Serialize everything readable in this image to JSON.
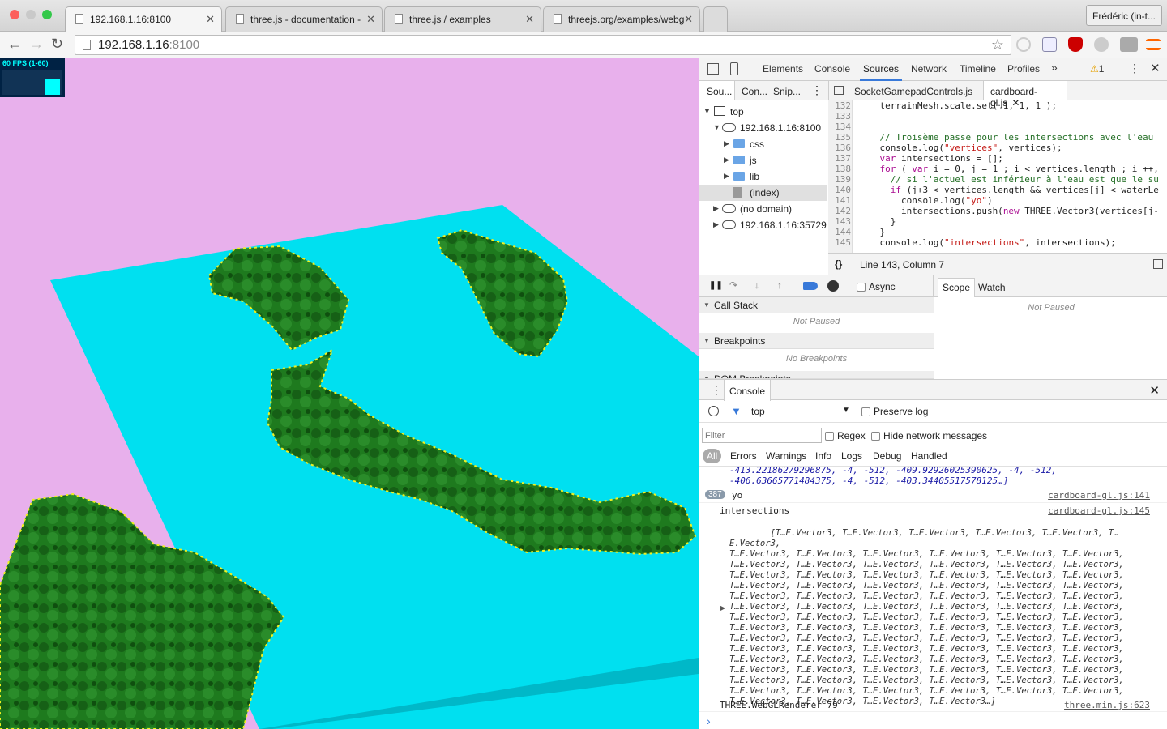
{
  "browser": {
    "tabs": [
      {
        "title": "192.168.1.16:8100",
        "active": true
      },
      {
        "title": "three.js - documentation - ",
        "active": false
      },
      {
        "title": "three.js / examples",
        "active": false
      },
      {
        "title": "threejs.org/examples/webg",
        "active": false
      }
    ],
    "profile": "Frédéric (in-t...",
    "url_host": "192.168.1.16",
    "url_port": ":8100"
  },
  "viewport": {
    "fps_label": "60 FPS (1-60)",
    "colors": {
      "background": "#e8b0ec",
      "water": "#00e0f0",
      "land": "#1e7a1e",
      "shoreline": "#f0f020"
    }
  },
  "devtools": {
    "tabs": [
      "Elements",
      "Console",
      "Sources",
      "Network",
      "Timeline",
      "Profiles"
    ],
    "selected_tab": "Sources",
    "warning_count": "1",
    "navigator_tabs": [
      "Sou...",
      "Con...",
      "Snip..."
    ],
    "file_tabs": [
      "SocketGamepadControls.js",
      "cardboard-gl.js"
    ],
    "tree": [
      {
        "label": "top",
        "icon": "frame-icon"
      },
      {
        "label": "192.168.1.16:8100",
        "icon": "cloud-icon"
      },
      {
        "label": "css",
        "icon": "folder-icon"
      },
      {
        "label": "js",
        "icon": "folder-icon"
      },
      {
        "label": "lib",
        "icon": "folder-icon"
      },
      {
        "label": "(index)",
        "icon": "file-icon"
      },
      {
        "label": "(no domain)",
        "icon": "cloud-icon"
      },
      {
        "label": "192.168.1.16:35729",
        "icon": "cloud-icon"
      }
    ],
    "code_lines": [
      {
        "n": "132",
        "text": "    terrainMesh.scale.set( 1, 1, 1 );"
      },
      {
        "n": "133",
        "text": ""
      },
      {
        "n": "134",
        "text": ""
      },
      {
        "n": "135",
        "text": "    // Troisème passe pour les intersections avec l'eau"
      },
      {
        "n": "136",
        "text": "    console.log(\"vertices\", vertices);"
      },
      {
        "n": "137",
        "text": "    var intersections = [];"
      },
      {
        "n": "138",
        "text": "    for ( var i = 0, j = 1 ; i < vertices.length ; i ++,"
      },
      {
        "n": "139",
        "text": "      // si l'actuel est inférieur à l'eau est que le su"
      },
      {
        "n": "140",
        "text": "      if (j+3 < vertices.length && vertices[j] < waterLe"
      },
      {
        "n": "141",
        "text": "        console.log(\"yo\")"
      },
      {
        "n": "142",
        "text": "        intersections.push(new THREE.Vector3(vertices[j-"
      },
      {
        "n": "143",
        "text": "      }"
      },
      {
        "n": "144",
        "text": "    }"
      },
      {
        "n": "145",
        "text": "    console.log(\"intersections\", intersections);"
      }
    ],
    "status_position": "Line 143, Column 7",
    "async_label": "Async",
    "call_stack": {
      "title": "Call Stack",
      "status": "Not Paused"
    },
    "breakpoints": {
      "title": "Breakpoints",
      "status": "No Breakpoints"
    },
    "dom_breakpoints": "DOM Breakpoints",
    "scope_tabs": [
      "Scope",
      "Watch"
    ],
    "scope_status": "Not Paused",
    "console": {
      "title": "Console",
      "context": "top",
      "preserve_log": "Preserve log",
      "filter_placeholder": "Filter",
      "regex": "Regex",
      "hide_network": "Hide network messages",
      "levels": [
        "All",
        "Errors",
        "Warnings",
        "Info",
        "Logs",
        "Debug",
        "Handled"
      ],
      "partial_lines": [
        "-413.22186279296875, -4, -512, -409.92926025390625, -4, -512,",
        "-406.63665771484375, -4, -512, -403.34405517578125…]"
      ],
      "yo_count": "387",
      "yo_text": "yo",
      "yo_source": "cardboard-gl.js:141",
      "intersections_label": "intersections",
      "intersections_source": "cardboard-gl.js:145",
      "vector_text": "T…E.Vector3",
      "renderer_text": "THREE.WebGLRenderer 79",
      "renderer_source": "three.min.js:623",
      "prompt": "›"
    }
  }
}
